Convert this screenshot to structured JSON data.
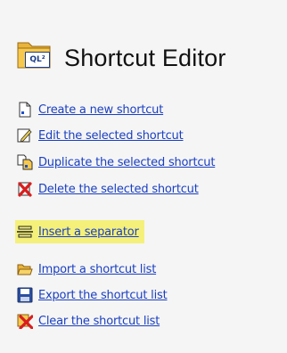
{
  "header": {
    "icon_text": "QL²",
    "title": "Shortcut Editor"
  },
  "menu": {
    "items": [
      {
        "label": "Create a new shortcut",
        "icon": "new-document-icon"
      },
      {
        "label": "Edit the selected shortcut",
        "icon": "pencil-edit-icon"
      },
      {
        "label": "Duplicate the selected shortcut",
        "icon": "duplicate-icon"
      },
      {
        "label": "Delete the selected shortcut",
        "icon": "delete-x-icon"
      },
      {
        "label": "Insert a separator",
        "icon": "separator-icon",
        "highlighted": true,
        "highlight_color": "#f4f07a"
      },
      {
        "label": "Import a shortcut list",
        "icon": "open-folder-icon"
      },
      {
        "label": "Export the shortcut list",
        "icon": "save-floppy-icon"
      },
      {
        "label": "Clear the shortcut list",
        "icon": "clear-list-icon"
      }
    ]
  },
  "colors": {
    "link": "#1a3fc1",
    "background": "#f5f5f5",
    "highlight": "#f4f07a",
    "delete_red": "#d81e1e"
  }
}
